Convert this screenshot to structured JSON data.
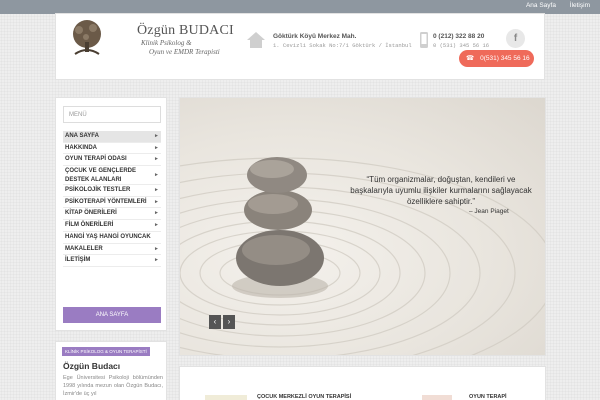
{
  "topbar": {
    "links": [
      "Ana Sayfa",
      "İletişim"
    ]
  },
  "brand": {
    "name": "Özgün BUDACI",
    "subtitle_line1": "Klinik Psikolog  &",
    "subtitle_line2": "Oyun ve EMDR Terapisti"
  },
  "contact": {
    "address_title": "Göktürk Köyü Merkez Mah.",
    "address_detail": "1. Cevizli Sokak No:7/1 Göktürk / İstanbul",
    "phone1": "0 (212) 322 88 20",
    "phone2": "0 (531) 345 56 16",
    "call_button": "0(531) 345 56 16",
    "facebook_label": "f"
  },
  "sidebar": {
    "search_placeholder": "MENÜ",
    "items": [
      {
        "label": "ANA SAYFA",
        "arrow": "►"
      },
      {
        "label": "HAKKINDA",
        "arrow": "►"
      },
      {
        "label": "OYUN TERAPİ ODASI",
        "arrow": "►"
      },
      {
        "label": "ÇOCUK VE GENÇLERDE DESTEK ALANLARI",
        "arrow": "►"
      },
      {
        "label": "PSİKOLOJİK TESTLER",
        "arrow": "►"
      },
      {
        "label": "PSİKOTERAPİ YÖNTEMLERİ",
        "arrow": "►"
      },
      {
        "label": "KİTAP ÖNERİLERİ",
        "arrow": "►"
      },
      {
        "label": "FİLM ÖNERİLERİ",
        "arrow": "►"
      },
      {
        "label": "HANGİ YAŞ HANGİ OYUNCAK",
        "arrow": ""
      },
      {
        "label": "MAKALELER",
        "arrow": "►"
      },
      {
        "label": "İLETİŞİM",
        "arrow": "►"
      }
    ],
    "active_button": "ANA SAYFA"
  },
  "profile": {
    "badge": "KLİNİK PSİKOLOG & OYUN TERAPİSTİ",
    "name": "Özgün Budacı",
    "text": "Ege Üniversitesi Psikoloji bölümünden 1998 yılında mezun olan Özgün Budacı, İzmir'de üç yıl"
  },
  "slider": {
    "quote": "“Tüm organizmalar, doğuştan, kendileri ve başkalarıyla uyumlu ilişkiler kurmalarını sağlayacak özelliklere sahiptir.”",
    "author": "– Jean Piaget",
    "prev": "‹",
    "next": "›"
  },
  "cards": [
    {
      "title": "ÇOCUK MERKEZLİ OYUN TERAPİSİ"
    },
    {
      "title": "OYUN TERAPİ"
    }
  ],
  "colors": {
    "accent_purple": "#9a7cc2",
    "call_red": "#ef6a5a",
    "topbar_gray": "#8e97a0"
  }
}
